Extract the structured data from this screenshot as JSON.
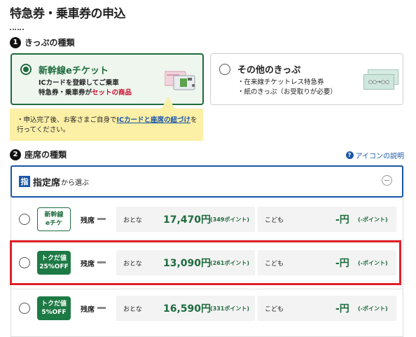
{
  "page": {
    "title": "特急券・乗車券の申込"
  },
  "ticket_type": {
    "heading_number": "1",
    "heading": "きっぷの種類",
    "options": [
      {
        "title": "新幹線eチケット",
        "selected": true,
        "desc_line1": "ICカードを登録してご乗車",
        "desc_line2_prefix": "特急券・乗車券が",
        "desc_line2_highlight": "セットの商品"
      },
      {
        "title": "その他のきっぷ",
        "selected": false,
        "desc_line1": "・在来線チケットレス特急券",
        "desc_line2": "・紙のきっぷ（お受取りが必要）",
        "image_text": "○○→○○"
      }
    ],
    "note": {
      "prefix": "・申込完了後、お客さまご自身で",
      "link": "ICカードと座席の紐づけ",
      "suffix": "を行ってください。"
    }
  },
  "seat_type": {
    "heading_number": "2",
    "heading": "座席の種類",
    "help_link": "アイコンの説明",
    "section_kanji": "指",
    "section_title": "指定席",
    "section_suffix": "から選ぶ",
    "rows": [
      {
        "badge_line1": "新幹線",
        "badge_line2": "eチケ",
        "badge_style": "outline",
        "remaining": "残席",
        "adult_label": "おとな",
        "adult_price": "17,470円",
        "adult_points": "(349ポイント)",
        "child_label": "こども",
        "child_price": "-円",
        "child_points": "(-ポイント)"
      },
      {
        "badge_line1": "トクだ値",
        "badge_line2": "25%OFF",
        "badge_style": "solid",
        "remaining": "残席",
        "adult_label": "おとな",
        "adult_price": "13,090円",
        "adult_points": "(261ポイント)",
        "child_label": "こども",
        "child_price": "-円",
        "child_points": "(-ポイント)"
      },
      {
        "badge_line1": "トクだ値",
        "badge_line2": "5%OFF",
        "badge_style": "solid",
        "remaining": "残席",
        "adult_label": "おとな",
        "adult_price": "16,590円",
        "adult_points": "(331ポイント)",
        "child_label": "こども",
        "child_price": "-円",
        "child_points": "(-ポイント)"
      }
    ]
  },
  "colors": {
    "accent_green": "#1e6b3e",
    "link_blue": "#1a56a7",
    "highlight_red": "#e0202a",
    "note_yellow": "#fcefa6"
  }
}
